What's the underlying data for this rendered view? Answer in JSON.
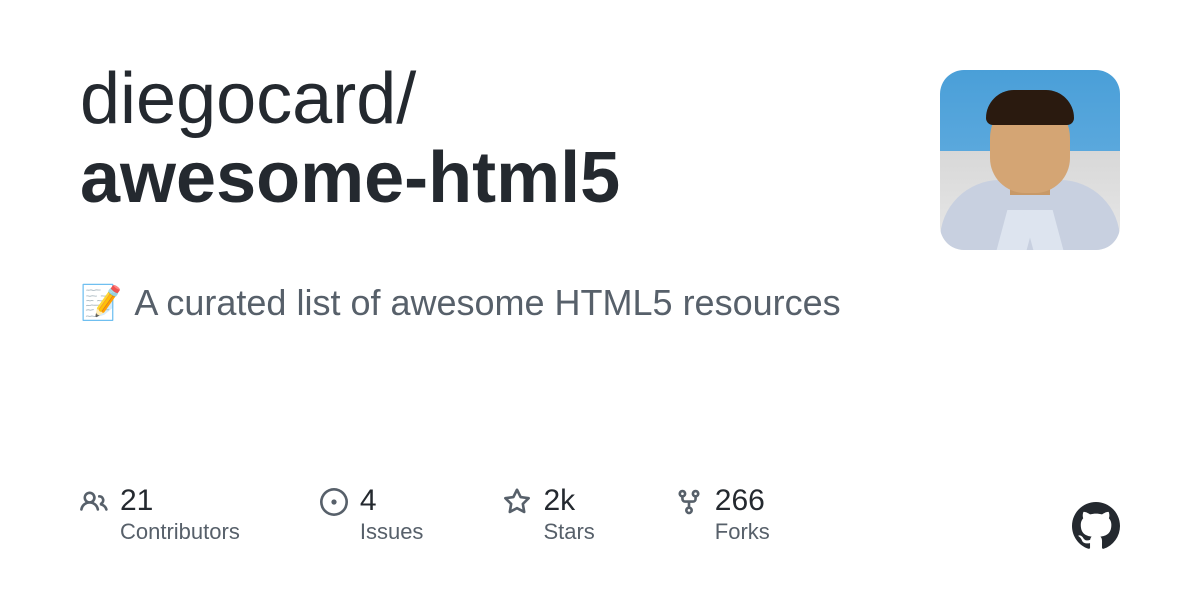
{
  "repo": {
    "owner": "diegocard",
    "name": "awesome-html5"
  },
  "description": {
    "emoji": "📝",
    "text": "A curated list of awesome HTML5 resources"
  },
  "stats": {
    "contributors": {
      "value": "21",
      "label": "Contributors"
    },
    "issues": {
      "value": "4",
      "label": "Issues"
    },
    "stars": {
      "value": "2k",
      "label": "Stars"
    },
    "forks": {
      "value": "266",
      "label": "Forks"
    }
  }
}
